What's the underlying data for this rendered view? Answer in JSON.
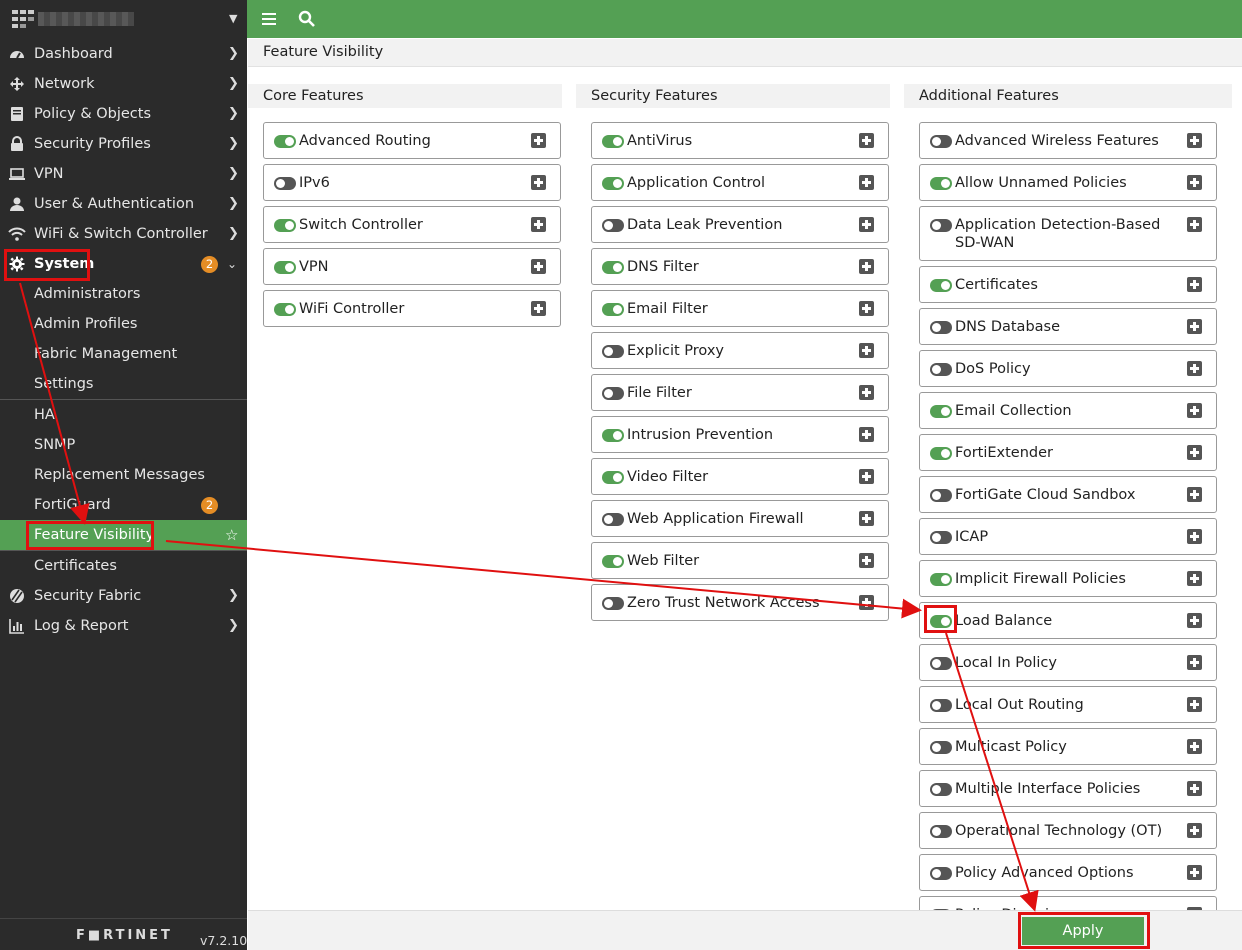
{
  "sidebar": {
    "hostname": "",
    "items": [
      {
        "label": "Dashboard",
        "icon": "dashboard-icon"
      },
      {
        "label": "Network",
        "icon": "network-icon"
      },
      {
        "label": "Policy & Objects",
        "icon": "policy-icon"
      },
      {
        "label": "Security Profiles",
        "icon": "lock-icon"
      },
      {
        "label": "VPN",
        "icon": "laptop-icon"
      },
      {
        "label": "User & Authentication",
        "icon": "user-icon"
      },
      {
        "label": "WiFi & Switch Controller",
        "icon": "wifi-icon"
      },
      {
        "label": "System",
        "icon": "gear-icon",
        "badge": "2"
      }
    ],
    "system_sub": [
      {
        "label": "Administrators"
      },
      {
        "label": "Admin Profiles"
      },
      {
        "label": "Fabric Management"
      },
      {
        "label": "Settings"
      },
      {
        "label": "HA"
      },
      {
        "label": "SNMP"
      },
      {
        "label": "Replacement Messages"
      },
      {
        "label": "FortiGuard",
        "badge": "2"
      },
      {
        "label": "Feature Visibility"
      },
      {
        "label": "Certificates"
      }
    ],
    "after_items": [
      {
        "label": "Security Fabric",
        "icon": "fabric-icon"
      },
      {
        "label": "Log & Report",
        "icon": "chart-icon"
      }
    ],
    "brand": "F■RTINET",
    "version": "v7.2.10"
  },
  "page": {
    "title": "Feature Visibility"
  },
  "columns": {
    "core": {
      "title": "Core Features",
      "items": [
        {
          "label": "Advanced Routing",
          "on": true
        },
        {
          "label": "IPv6",
          "on": false
        },
        {
          "label": "Switch Controller",
          "on": true
        },
        {
          "label": "VPN",
          "on": true
        },
        {
          "label": "WiFi Controller",
          "on": true
        }
      ]
    },
    "security": {
      "title": "Security Features",
      "items": [
        {
          "label": "AntiVirus",
          "on": true
        },
        {
          "label": "Application Control",
          "on": true
        },
        {
          "label": "Data Leak Prevention",
          "on": false
        },
        {
          "label": "DNS Filter",
          "on": true
        },
        {
          "label": "Email Filter",
          "on": true
        },
        {
          "label": "Explicit Proxy",
          "on": false
        },
        {
          "label": "File Filter",
          "on": false
        },
        {
          "label": "Intrusion Prevention",
          "on": true
        },
        {
          "label": "Video Filter",
          "on": true
        },
        {
          "label": "Web Application Firewall",
          "on": false
        },
        {
          "label": "Web Filter",
          "on": true
        },
        {
          "label": "Zero Trust Network Access",
          "on": false
        }
      ]
    },
    "additional": {
      "title": "Additional Features",
      "items": [
        {
          "label": "Advanced Wireless Features",
          "on": false
        },
        {
          "label": "Allow Unnamed Policies",
          "on": true
        },
        {
          "label": "Application Detection-Based SD-WAN",
          "on": false
        },
        {
          "label": "Certificates",
          "on": true
        },
        {
          "label": "DNS Database",
          "on": false
        },
        {
          "label": "DoS Policy",
          "on": false
        },
        {
          "label": "Email Collection",
          "on": true
        },
        {
          "label": "FortiExtender",
          "on": true
        },
        {
          "label": "FortiGate Cloud Sandbox",
          "on": false
        },
        {
          "label": "ICAP",
          "on": false
        },
        {
          "label": "Implicit Firewall Policies",
          "on": true
        },
        {
          "label": "Load Balance",
          "on": true
        },
        {
          "label": "Local In Policy",
          "on": false
        },
        {
          "label": "Local Out Routing",
          "on": false
        },
        {
          "label": "Multicast Policy",
          "on": false
        },
        {
          "label": "Multiple Interface Policies",
          "on": false
        },
        {
          "label": "Operational Technology (OT)",
          "on": false
        },
        {
          "label": "Policy Advanced Options",
          "on": false
        },
        {
          "label": "Policy Disclaimer",
          "on": false
        }
      ]
    }
  },
  "footer": {
    "apply_label": "Apply"
  },
  "colors": {
    "accent_green": "#54a054",
    "sidebar_bg": "#2b2b2b",
    "badge_orange": "#e58d25",
    "annotation_red": "#e01010"
  }
}
